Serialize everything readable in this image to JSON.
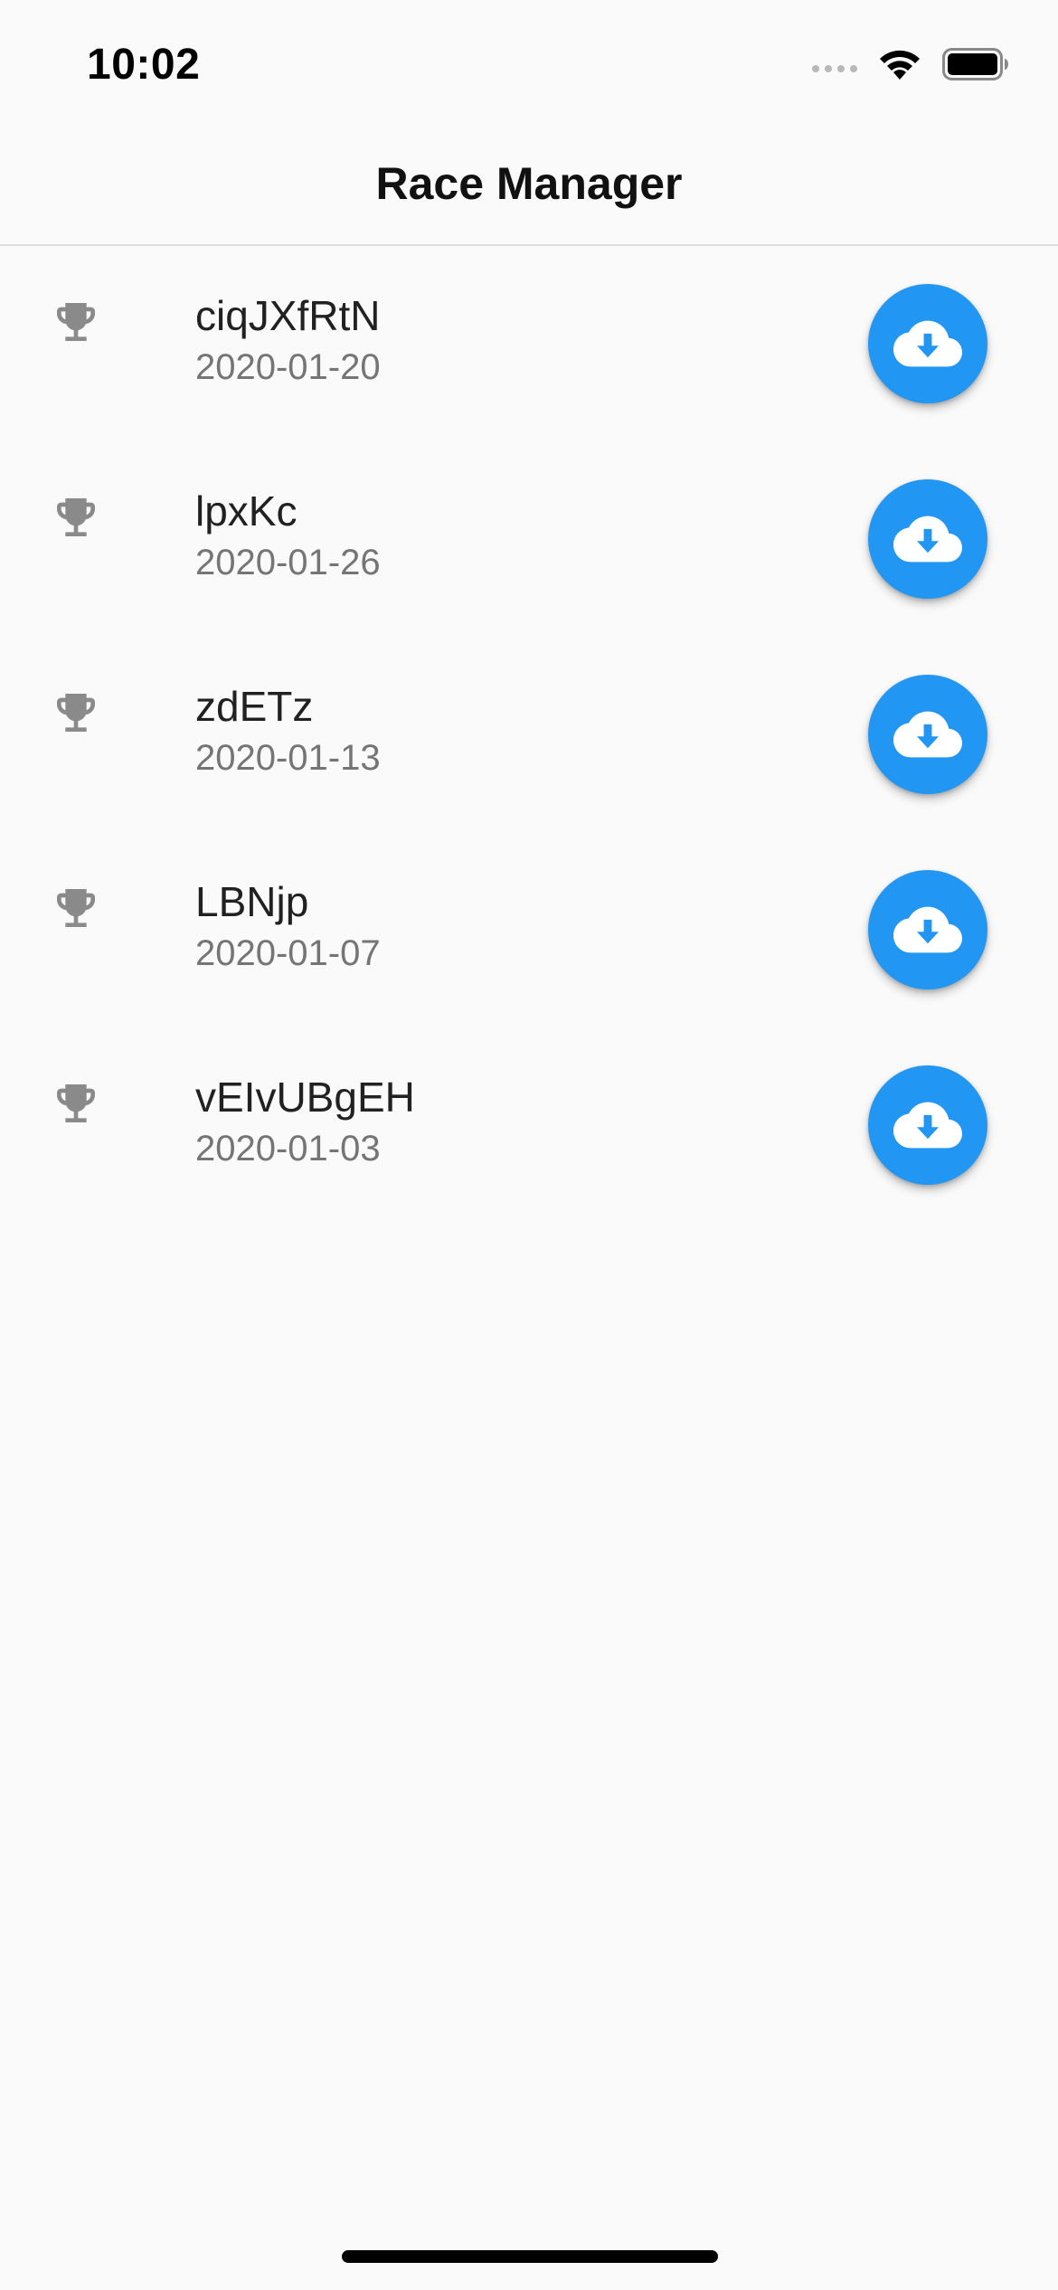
{
  "status_bar": {
    "time": "10:02",
    "icons": [
      "cellular-signal-icon",
      "wifi-icon",
      "battery-icon"
    ]
  },
  "nav": {
    "title": "Race Manager"
  },
  "races": [
    {
      "name": "ciqJXfRtN",
      "date": "2020-01-20",
      "icon": "trophy-icon",
      "action_icon": "cloud-download-icon"
    },
    {
      "name": "lpxKc",
      "date": "2020-01-26",
      "icon": "trophy-icon",
      "action_icon": "cloud-download-icon"
    },
    {
      "name": "zdETz",
      "date": "2020-01-13",
      "icon": "trophy-icon",
      "action_icon": "cloud-download-icon"
    },
    {
      "name": "LBNjp",
      "date": "2020-01-07",
      "icon": "trophy-icon",
      "action_icon": "cloud-download-icon"
    },
    {
      "name": "vEIvUBgEH",
      "date": "2020-01-03",
      "icon": "trophy-icon",
      "action_icon": "cloud-download-icon"
    }
  ],
  "colors": {
    "background": "#fafafa",
    "accent": "#2196f3",
    "trophy": "#8a8a8a",
    "title_text": "#212121",
    "subtitle_text": "#757575"
  }
}
